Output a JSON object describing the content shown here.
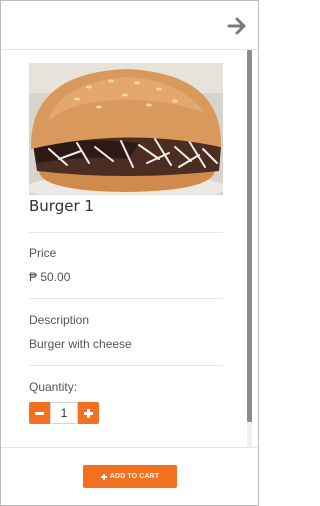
{
  "product": {
    "name": "Burger 1",
    "price_label": "Price",
    "price_value": "₱ 50.00",
    "description_label": "Description",
    "description_value": "Burger with cheese",
    "quantity_label": "Quantity:",
    "quantity_value": "1"
  },
  "footer": {
    "add_to_cart_label": "ADD TO CART"
  },
  "icons": {
    "close": "arrow-right-icon",
    "minus": "minus-icon",
    "plus": "plus-icon",
    "cart_plus": "plus-icon"
  },
  "colors": {
    "accent": "#f37021"
  }
}
